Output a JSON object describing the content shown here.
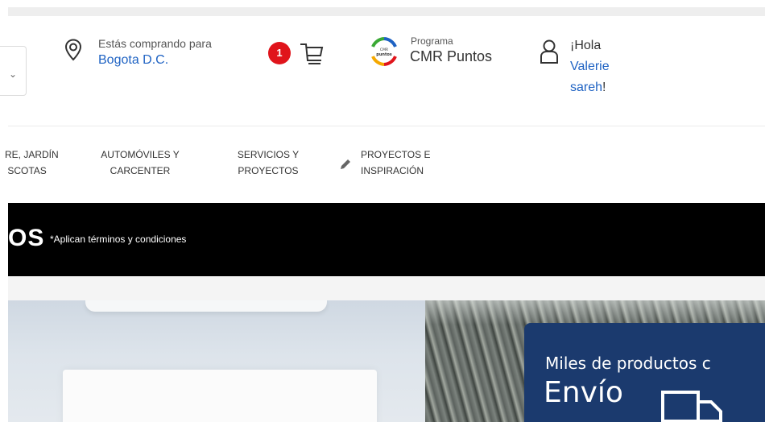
{
  "header": {
    "location": {
      "label": "Estás comprando para",
      "city": "Bogota D.C."
    },
    "cart": {
      "count": "1"
    },
    "cmr": {
      "program_label": "Programa",
      "name": "CMR Puntos",
      "logo_text_top": "CMR",
      "logo_text_bottom": "puntos"
    },
    "user": {
      "greeting": "¡Hola",
      "first_name": "Valerie",
      "last_name": "sareh",
      "exclaim": "!"
    },
    "search_hint": "⌄"
  },
  "nav": {
    "items": [
      {
        "line1": "RE, JARDÍN",
        "line2": " SCOTAS"
      },
      {
        "line1": "AUTOMÓVILES Y",
        "line2": "CARCENTER"
      },
      {
        "line1": "SERVICIOS Y",
        "line2": "PROYECTOS"
      },
      {
        "line1": "PROYECTOS E",
        "line2": "INSPIRACIÓN"
      }
    ]
  },
  "promo": {
    "big_text": "OS",
    "terms": "*Aplican términos y condiciones"
  },
  "banner": {
    "line1": "Miles de productos c",
    "line2": "Envío"
  },
  "colors": {
    "link": "#1e62c3",
    "badge": "#e0141b",
    "promo_bg": "#000000",
    "banner_panel": "#1b3a6e"
  },
  "icons": [
    "location-pin-icon",
    "cart-icon",
    "cmr-puntos-logo",
    "user-icon",
    "pencil-icon",
    "truck-icon"
  ]
}
